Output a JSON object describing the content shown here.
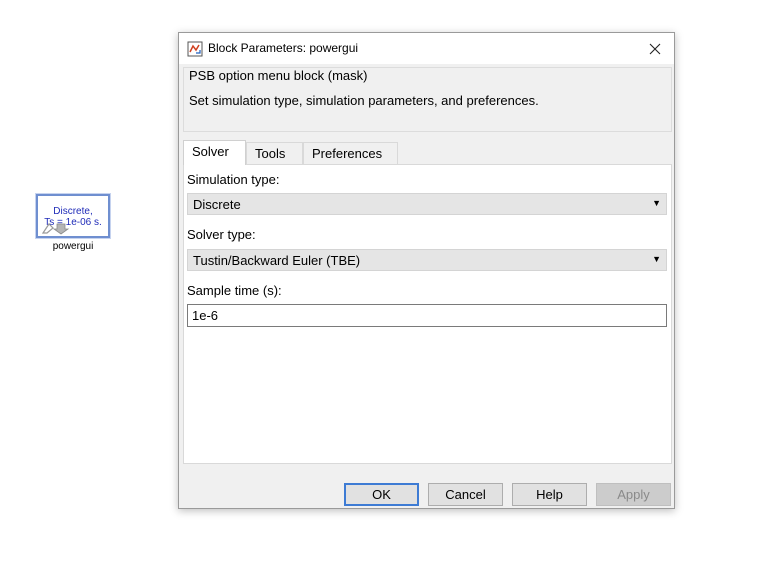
{
  "canvas_block": {
    "line1": "Discrete,",
    "line2": "Ts = 1e-06 s.",
    "name": "powergui"
  },
  "dialog": {
    "title": "Block Parameters: powergui",
    "mask_title": "PSB option menu block (mask)",
    "mask_description": "Set simulation type, simulation parameters, and preferences.",
    "tabs": [
      {
        "label": "Solver",
        "active": true
      },
      {
        "label": "Tools",
        "active": false
      },
      {
        "label": "Preferences",
        "active": false
      }
    ],
    "fields": {
      "simulation_type": {
        "label": "Simulation type:",
        "value": "Discrete"
      },
      "solver_type": {
        "label": "Solver type:",
        "value": "Tustin/Backward Euler (TBE)"
      },
      "sample_time": {
        "label": "Sample time (s):",
        "value": "1e-6"
      }
    },
    "buttons": {
      "ok": "OK",
      "cancel": "Cancel",
      "help": "Help",
      "apply": "Apply"
    }
  },
  "colors": {
    "block_text": "#1f2bb8",
    "block_border": "#6f8fd0",
    "default_button_border": "#3d7bd4"
  }
}
